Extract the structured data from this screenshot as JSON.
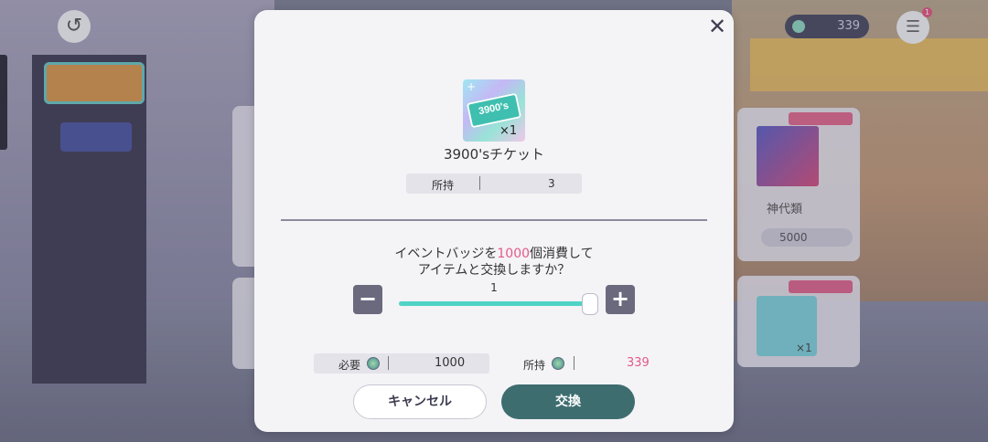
{
  "top_bar": {
    "currency_value": "339",
    "menu_badge": "1"
  },
  "background": {
    "card_name": "神代類",
    "card_cost": "5000",
    "card_qty": "×1"
  },
  "dialog": {
    "close_icon": "close-icon",
    "item": {
      "quantity": "×1",
      "ticket_text": "3900's",
      "name": "3900'sチケット"
    },
    "owned": {
      "label": "所持",
      "value": "3"
    },
    "message": {
      "line1_prefix": "イベントバッジを",
      "cost": "1000",
      "line1_suffix": "個消費して",
      "line2": "アイテムと交換しますか？"
    },
    "amount": {
      "count": "1",
      "minus_icon": "−",
      "plus_icon": "+",
      "slider_fraction": 1.0
    },
    "required": {
      "label": "必要",
      "value": "1000"
    },
    "have": {
      "label": "所持",
      "value": "339"
    },
    "buttons": {
      "cancel": "キャンセル",
      "confirm": "交換"
    },
    "colors": {
      "highlight": "#e35a8b",
      "accent": "#4fd3c6",
      "confirm_bg": "#3e6d70"
    }
  }
}
